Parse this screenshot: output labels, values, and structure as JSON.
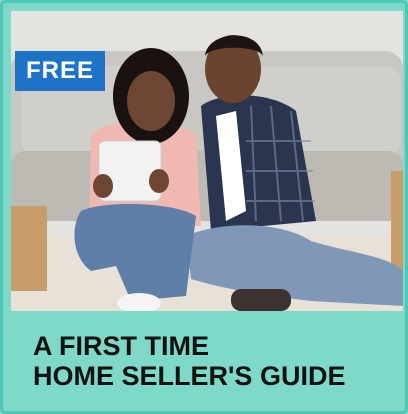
{
  "promo": {
    "badge": "FREE",
    "title_line_1": "A FIRST TIME",
    "title_line_2": "HOME SELLER'S GUIDE"
  },
  "colors": {
    "card_background": "#7ed9c9",
    "card_border": "#4fc7b6",
    "badge_background": "#1f73c7",
    "badge_text": "#ffffff",
    "title_text": "#111111"
  },
  "image": {
    "subject": "couple-on-floor-with-tablet-illustration"
  }
}
